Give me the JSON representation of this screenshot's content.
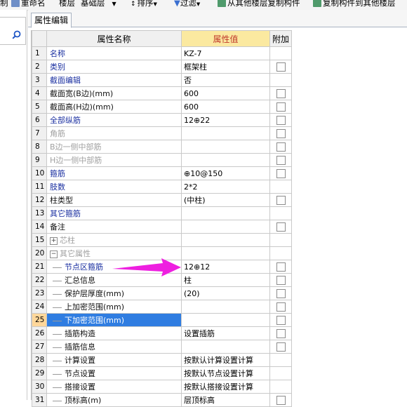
{
  "toolbar": {
    "items": [
      "制",
      "重命名",
      "楼层",
      "基础层",
      "排序",
      "过滤",
      "从其他楼层复制构件",
      "复制构件到其他楼层"
    ]
  },
  "tab": {
    "label": "属性编辑"
  },
  "columns": {
    "name": "属性名称",
    "value": "属性值",
    "extra": "附加"
  },
  "rows": [
    {
      "n": "1",
      "name": "名称",
      "value": "KZ-7",
      "color": "blue",
      "check": false,
      "indent": 0
    },
    {
      "n": "2",
      "name": "类别",
      "value": "框架柱",
      "color": "blue",
      "check": true,
      "indent": 0
    },
    {
      "n": "3",
      "name": "截面编辑",
      "value": "否",
      "color": "blue",
      "check": false,
      "indent": 0
    },
    {
      "n": "4",
      "name": "截面宽(B边)(mm)",
      "value": "600",
      "color": "black",
      "check": true,
      "indent": 0
    },
    {
      "n": "5",
      "name": "截面高(H边)(mm)",
      "value": "600",
      "color": "black",
      "check": true,
      "indent": 0
    },
    {
      "n": "6",
      "name": "全部纵筋",
      "value": "12⊕22",
      "color": "blue",
      "check": true,
      "indent": 0
    },
    {
      "n": "7",
      "name": "角筋",
      "value": "",
      "color": "gray",
      "check": true,
      "indent": 0
    },
    {
      "n": "8",
      "name": "B边一侧中部筋",
      "value": "",
      "color": "gray",
      "check": true,
      "indent": 0
    },
    {
      "n": "9",
      "name": "H边一侧中部筋",
      "value": "",
      "color": "gray",
      "check": true,
      "indent": 0
    },
    {
      "n": "10",
      "name": "箍筋",
      "value": "⊕10@150",
      "color": "blue",
      "check": true,
      "indent": 0
    },
    {
      "n": "11",
      "name": "肢数",
      "value": "2*2",
      "color": "blue",
      "check": false,
      "indent": 0
    },
    {
      "n": "12",
      "name": "柱类型",
      "value": "(中柱)",
      "color": "black",
      "check": true,
      "indent": 0
    },
    {
      "n": "13",
      "name": "其它箍筋",
      "value": "",
      "color": "blue",
      "check": false,
      "indent": 0
    },
    {
      "n": "14",
      "name": "备注",
      "value": "",
      "color": "black",
      "check": true,
      "indent": 0
    },
    {
      "n": "15",
      "name": "芯柱",
      "value": "",
      "color": "gray",
      "check": false,
      "indent": 0,
      "expander": "+"
    },
    {
      "n": "20",
      "name": "其它属性",
      "value": "",
      "color": "gray",
      "check": false,
      "indent": 0,
      "expander": "−"
    },
    {
      "n": "21",
      "name": "节点区箍筋",
      "value": "12⊕12",
      "color": "blue",
      "check": true,
      "indent": 1
    },
    {
      "n": "22",
      "name": "汇总信息",
      "value": "柱",
      "color": "black",
      "check": true,
      "indent": 1
    },
    {
      "n": "23",
      "name": "保护层厚度(mm)",
      "value": "(20)",
      "color": "black",
      "check": true,
      "indent": 1
    },
    {
      "n": "24",
      "name": "上加密范围(mm)",
      "value": "",
      "color": "black",
      "check": true,
      "indent": 1
    },
    {
      "n": "25",
      "name": "下加密范围(mm)",
      "value": "",
      "color": "black",
      "check": true,
      "indent": 1,
      "selected": true
    },
    {
      "n": "26",
      "name": "插筋构造",
      "value": "设置插筋",
      "color": "black",
      "check": true,
      "indent": 1
    },
    {
      "n": "27",
      "name": "插筋信息",
      "value": "",
      "color": "black",
      "check": true,
      "indent": 1
    },
    {
      "n": "28",
      "name": "计算设置",
      "value": "按默认计算设置计算",
      "color": "black",
      "check": false,
      "indent": 1
    },
    {
      "n": "29",
      "name": "节点设置",
      "value": "按默认节点设置计算",
      "color": "black",
      "check": false,
      "indent": 1
    },
    {
      "n": "30",
      "name": "搭接设置",
      "value": "按默认搭接设置计算",
      "color": "black",
      "check": false,
      "indent": 1
    },
    {
      "n": "31",
      "name": "顶标高(m)",
      "value": "层顶标高",
      "color": "black",
      "check": true,
      "indent": 1
    }
  ],
  "colors": {
    "annotation_arrow": "#ee1fe0",
    "selection": "#2f7de1",
    "value_header_bg": "#fbe9a0"
  }
}
